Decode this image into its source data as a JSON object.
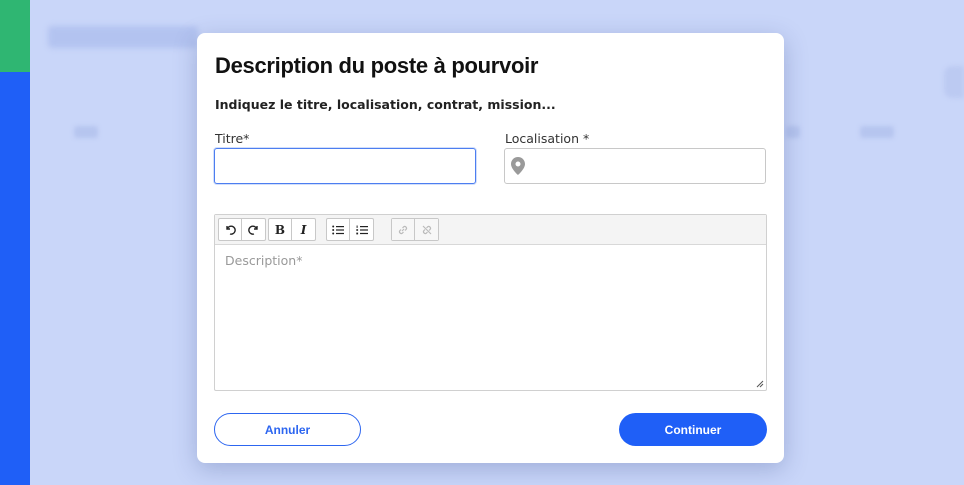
{
  "modal": {
    "title": "Description du poste à pourvoir",
    "subtitle": "Indiquez le titre, localisation, contrat, mission...",
    "fields": {
      "titre": {
        "label": "Titre*",
        "value": "",
        "placeholder": ""
      },
      "localisation": {
        "label": "Localisation *",
        "value": "",
        "placeholder": "",
        "icon": "map-pin-icon"
      }
    },
    "editor": {
      "placeholder": "Description*",
      "toolbar": [
        {
          "name": "undo-button",
          "icon": "undo-icon",
          "glyph": "↺"
        },
        {
          "name": "redo-button",
          "icon": "redo-icon",
          "glyph": "↻"
        },
        {
          "name": "bold-button",
          "icon": "bold-icon",
          "glyph": "B"
        },
        {
          "name": "italic-button",
          "icon": "italic-icon",
          "glyph": "I"
        },
        {
          "name": "bullet-list-button",
          "icon": "bullet-list-icon",
          "glyph": "☰"
        },
        {
          "name": "numbered-list-button",
          "icon": "numbered-list-icon",
          "glyph": "☷"
        },
        {
          "name": "link-button",
          "icon": "link-icon",
          "glyph": "🔗",
          "disabled": true
        },
        {
          "name": "unlink-button",
          "icon": "unlink-icon",
          "glyph": "⛓",
          "disabled": true
        }
      ]
    },
    "buttons": {
      "cancel": "Annuler",
      "continue": "Continuer"
    }
  },
  "colors": {
    "primary": "#1f5ff7",
    "overlay": "#c9d6f9",
    "sidebar_accent": "#2fb672"
  }
}
